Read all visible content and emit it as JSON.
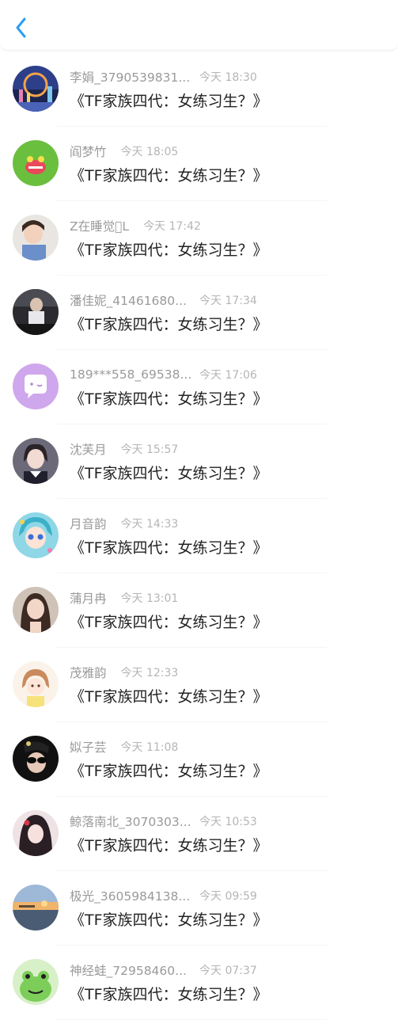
{
  "header": {
    "back_icon": "chevron-left-icon",
    "accent": "#2a9df4"
  },
  "messages": [
    {
      "name": "李娟_3790539831...",
      "time": "今天 18:30",
      "text": "《TF家族四代：女练习生？》",
      "avatar": "city-skyline-avatar",
      "long": true
    },
    {
      "name": "阎梦竹",
      "time": "今天 18:05",
      "text": "《TF家族四代：女练习生？》",
      "avatar": "green-cartoon-avatar",
      "long": false
    },
    {
      "name": "Z在睡觉\u0000L",
      "time": "今天 17:42",
      "text": "《TF家族四代：女练习生？》",
      "avatar": "child-photo-avatar",
      "long": false
    },
    {
      "name": "潘佳妮_41461680...",
      "time": "今天 17:34",
      "text": "《TF家族四代：女练习生？》",
      "avatar": "piano-photo-avatar",
      "long": true
    },
    {
      "name": "189***558_69538...",
      "time": "今天 17:06",
      "text": "《TF家族四代：女练习生？》",
      "avatar": "purple-chat-avatar",
      "long": true
    },
    {
      "name": "沈芙月",
      "time": "今天 15:57",
      "text": "《TF家族四代：女练习生？》",
      "avatar": "girl-photo-avatar",
      "long": false
    },
    {
      "name": "月音韵",
      "time": "今天 14:33",
      "text": "《TF家族四代：女练习生？》",
      "avatar": "anime-girl-avatar",
      "long": false
    },
    {
      "name": "蒲月冉",
      "time": "今天 13:01",
      "text": "《TF家族四代：女练习生？》",
      "avatar": "girl-portrait-avatar",
      "long": false
    },
    {
      "name": "茂雅韵",
      "time": "今天 12:33",
      "text": "《TF家族四代：女练习生？》",
      "avatar": "cartoon-girl-avatar",
      "long": false
    },
    {
      "name": "姒子芸",
      "time": "今天 11:08",
      "text": "《TF家族四代：女练习生？》",
      "avatar": "sunglasses-girl-avatar",
      "long": false
    },
    {
      "name": "鲸落南北_3070303...",
      "time": "今天 10:53",
      "text": "《TF家族四代：女练习生？》",
      "avatar": "dark-hair-girl-avatar",
      "long": true
    },
    {
      "name": "极光_3605984138...",
      "time": "今天 09:59",
      "text": "《TF家族四代：女练习生？》",
      "avatar": "sunset-beach-avatar",
      "long": true
    },
    {
      "name": "神经蛙_72958460...",
      "time": "今天 07:37",
      "text": "《TF家族四代：女练习生？》",
      "avatar": "green-frog-avatar",
      "long": true
    }
  ]
}
